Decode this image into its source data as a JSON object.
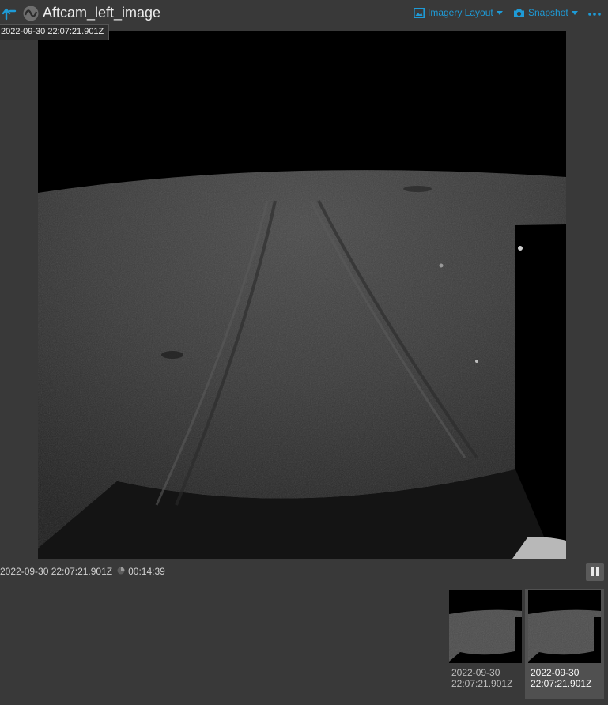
{
  "header": {
    "title": "Aftcam_left_image",
    "imagery_layout_label": "Imagery Layout",
    "snapshot_label": "Snapshot",
    "back_icon": "back-arrow-icon",
    "type_icon": "waveform-icon",
    "more_icon": "more-horizontal-icon"
  },
  "timestamp_tooltip": "2022-09-30 22:07:21.901Z",
  "viewer": {
    "image_description_icon": "lunar-surface-image"
  },
  "status": {
    "timestamp": "2022-09-30 22:07:21.901Z",
    "elapsed": "00:14:39",
    "clock_icon": "clock-icon",
    "pause_icon": "pause-icon"
  },
  "thumbnails": [
    {
      "date": "2022-09-30",
      "time": "22:07:21.901Z",
      "selected": false
    },
    {
      "date": "2022-09-30",
      "time": "22:07:21.901Z",
      "selected": true
    }
  ],
  "colors": {
    "accent": "#1e9bd7",
    "background": "#393939",
    "image_bg": "#000000"
  }
}
